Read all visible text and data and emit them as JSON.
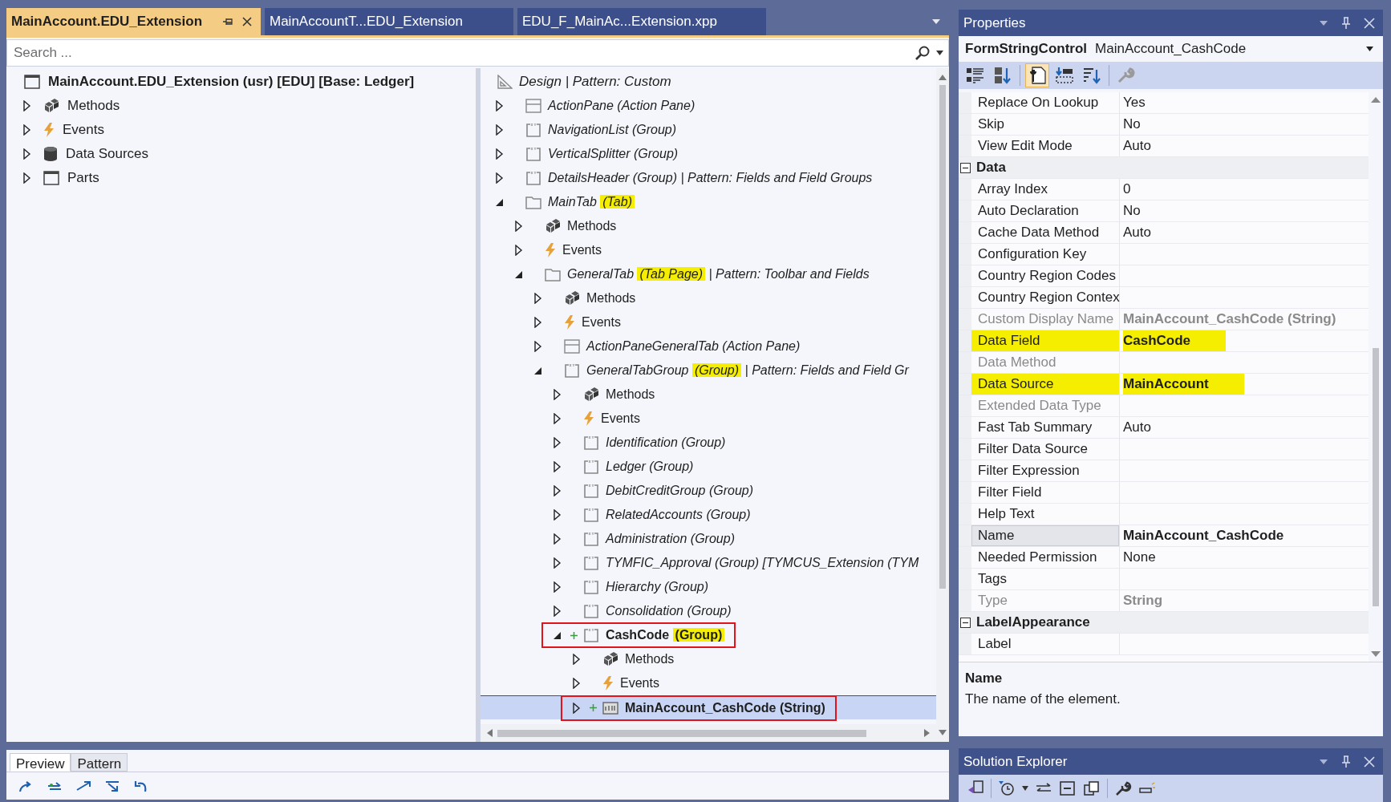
{
  "doc_tabs": [
    {
      "label": "MainAccount.EDU_Extension",
      "selected": true
    },
    {
      "label": "MainAccountT...EDU_Extension",
      "selected": false
    },
    {
      "label": "EDU_F_MainAc...Extension.xpp",
      "selected": false
    }
  ],
  "search": {
    "placeholder": "Search ..."
  },
  "element_tree": {
    "root": "MainAccount.EDU_Extension (usr) [EDU] [Base: Ledger]",
    "items": [
      {
        "name": "Methods",
        "kind": "methods",
        "expanded": false
      },
      {
        "name": "Events",
        "kind": "events",
        "expanded": false
      },
      {
        "name": "Data Sources",
        "kind": "datasource",
        "expanded": false
      },
      {
        "name": "Parts",
        "kind": "window",
        "expanded": false
      }
    ]
  },
  "designer": {
    "header": {
      "name": "Design",
      "suffix": " | Pattern: Custom"
    },
    "items": [
      {
        "name": "ActionPane",
        "type": "(Action Pane)",
        "kind": "actionpane",
        "expanded": false,
        "selected": false,
        "added": false,
        "highlighted": false
      },
      {
        "name": "NavigationList",
        "type": "(Group)",
        "kind": "group",
        "expanded": false,
        "selected": false,
        "added": false,
        "highlighted": false
      },
      {
        "name": "VerticalSplitter",
        "type": "(Group)",
        "kind": "group",
        "expanded": false,
        "selected": false,
        "added": false,
        "highlighted": false
      },
      {
        "name": "DetailsHeader",
        "type": "(Group)",
        "suffix": " | Pattern: Fields and Field Groups",
        "kind": "group",
        "expanded": false,
        "selected": false,
        "added": false,
        "highlighted": false
      },
      {
        "name": "MainTab",
        "type": "(Tab)",
        "kind": "tab",
        "expanded": true,
        "selected": false,
        "added": false,
        "highlighted": true,
        "children": [
          {
            "name": "Methods",
            "kind": "methods",
            "expanded": false,
            "selected": false,
            "added": false
          },
          {
            "name": "Events",
            "kind": "events",
            "expanded": false,
            "selected": false,
            "added": false
          },
          {
            "name": "GeneralTab",
            "type": "(Tab Page)",
            "suffix": " | Pattern: Toolbar and Fields",
            "kind": "tab",
            "expanded": true,
            "selected": false,
            "added": false,
            "highlighted": true,
            "children": [
              {
                "name": "Methods",
                "kind": "methods",
                "expanded": false,
                "selected": false,
                "added": false
              },
              {
                "name": "Events",
                "kind": "events",
                "expanded": false,
                "selected": false,
                "added": false
              },
              {
                "name": "ActionPaneGeneralTab",
                "type": "(Action Pane)",
                "kind": "actionpane",
                "expanded": false,
                "selected": false,
                "added": false,
                "highlighted": false
              },
              {
                "name": "GeneralTabGroup",
                "type": "(Group)",
                "suffix": " | Pattern: Fields and Field Gr",
                "kind": "group",
                "expanded": true,
                "selected": false,
                "added": false,
                "highlighted": true,
                "children": [
                  {
                    "name": "Methods",
                    "kind": "methods",
                    "expanded": false,
                    "selected": false,
                    "added": false
                  },
                  {
                    "name": "Events",
                    "kind": "events",
                    "expanded": false,
                    "selected": false,
                    "added": false
                  },
                  {
                    "name": "Identification",
                    "type": "(Group)",
                    "kind": "group",
                    "expanded": false,
                    "selected": false,
                    "added": false,
                    "highlighted": false
                  },
                  {
                    "name": "Ledger",
                    "type": "(Group)",
                    "kind": "group",
                    "expanded": false,
                    "selected": false,
                    "added": false,
                    "highlighted": false
                  },
                  {
                    "name": "DebitCreditGroup",
                    "type": "(Group)",
                    "kind": "group",
                    "expanded": false,
                    "selected": false,
                    "added": false,
                    "highlighted": false
                  },
                  {
                    "name": "RelatedAccounts",
                    "type": "(Group)",
                    "kind": "group",
                    "expanded": false,
                    "selected": false,
                    "added": false,
                    "highlighted": false
                  },
                  {
                    "name": "Administration",
                    "type": "(Group)",
                    "kind": "group",
                    "expanded": false,
                    "selected": false,
                    "added": false,
                    "highlighted": false
                  },
                  {
                    "name": "TYMFIC_Approval",
                    "type": "(Group)",
                    "suffix": " [TYMCUS_Extension (TYM",
                    "kind": "group",
                    "expanded": false,
                    "selected": false,
                    "added": false,
                    "highlighted": false
                  },
                  {
                    "name": "Hierarchy",
                    "type": "(Group)",
                    "kind": "group",
                    "expanded": false,
                    "selected": false,
                    "added": false,
                    "highlighted": false
                  },
                  {
                    "name": "Consolidation",
                    "type": "(Group)",
                    "kind": "group",
                    "expanded": false,
                    "selected": false,
                    "added": false,
                    "highlighted": false
                  },
                  {
                    "name": "CashCode",
                    "type": "(Group)",
                    "kind": "group",
                    "expanded": true,
                    "selected": false,
                    "added": true,
                    "highlighted": true,
                    "children": [
                      {
                        "name": "Methods",
                        "kind": "methods",
                        "expanded": false,
                        "selected": false,
                        "added": false
                      },
                      {
                        "name": "Events",
                        "kind": "events",
                        "expanded": false,
                        "selected": false,
                        "added": false
                      },
                      {
                        "name": "MainAccount_CashCode",
                        "type": "(String)",
                        "kind": "string",
                        "expanded": false,
                        "selected": true,
                        "added": true,
                        "highlighted": false
                      }
                    ]
                  }
                ]
              }
            ]
          }
        ]
      }
    ]
  },
  "preview_panel": {
    "tabs": [
      {
        "label": "Preview",
        "selected": true
      },
      {
        "label": "Pattern",
        "selected": false
      }
    ]
  },
  "properties": {
    "title": "Properties",
    "object_type": "FormStringControl",
    "object_name": "MainAccount_CashCode",
    "toolbar": [
      {
        "kind": "categorized",
        "selected": false
      },
      {
        "kind": "alphabetical",
        "selected": false
      },
      {
        "kind": "property-pages",
        "selected": true
      },
      {
        "kind": "events",
        "selected": false
      },
      {
        "kind": "sort",
        "selected": false
      },
      {
        "kind": "wrench",
        "selected": false
      }
    ],
    "rows": [
      {
        "kind": "property",
        "name": "Replace On Lookup",
        "value": "Yes",
        "readonly": false,
        "modified": false,
        "highlighted": false,
        "selected": false
      },
      {
        "kind": "property",
        "name": "Skip",
        "value": "No",
        "readonly": false,
        "modified": false,
        "highlighted": false,
        "selected": false
      },
      {
        "kind": "property",
        "name": "View Edit Mode",
        "value": "Auto",
        "readonly": false,
        "modified": false,
        "highlighted": false,
        "selected": false
      },
      {
        "kind": "category",
        "name": "Data",
        "expanded": true
      },
      {
        "kind": "property",
        "name": "Array Index",
        "value": "0",
        "readonly": false,
        "modified": false,
        "highlighted": false,
        "selected": false
      },
      {
        "kind": "property",
        "name": "Auto Declaration",
        "value": "No",
        "readonly": false,
        "modified": false,
        "highlighted": false,
        "selected": false
      },
      {
        "kind": "property",
        "name": "Cache Data Method",
        "value": "Auto",
        "readonly": false,
        "modified": false,
        "highlighted": false,
        "selected": false
      },
      {
        "kind": "property",
        "name": "Configuration Key",
        "readonly": false,
        "highlighted": false,
        "selected": false
      },
      {
        "kind": "property",
        "name": "Country Region Codes",
        "readonly": false,
        "highlighted": false,
        "selected": false
      },
      {
        "kind": "property",
        "name": "Country Region Contex",
        "readonly": false,
        "highlighted": false,
        "selected": false
      },
      {
        "kind": "property",
        "name": "Custom Display Name",
        "value": "MainAccount_CashCode (String)",
        "readonly": true,
        "modified": true,
        "highlighted": false,
        "selected": false
      },
      {
        "kind": "property",
        "name": "Data Field",
        "value": "CashCode",
        "readonly": false,
        "modified": true,
        "highlighted": true,
        "selected": false
      },
      {
        "kind": "property",
        "name": "Data Method",
        "readonly": true,
        "highlighted": false,
        "selected": false
      },
      {
        "kind": "property",
        "name": "Data Source",
        "value": "MainAccount",
        "readonly": false,
        "modified": true,
        "highlighted": true,
        "selected": false
      },
      {
        "kind": "property",
        "name": "Extended Data Type",
        "readonly": true,
        "highlighted": false,
        "selected": false
      },
      {
        "kind": "property",
        "name": "Fast Tab Summary",
        "value": "Auto",
        "readonly": false,
        "modified": false,
        "highlighted": false,
        "selected": false
      },
      {
        "kind": "property",
        "name": "Filter Data Source",
        "readonly": false,
        "highlighted": false,
        "selected": false
      },
      {
        "kind": "property",
        "name": "Filter Expression",
        "readonly": false,
        "highlighted": false,
        "selected": false
      },
      {
        "kind": "property",
        "name": "Filter Field",
        "readonly": false,
        "highlighted": false,
        "selected": false
      },
      {
        "kind": "property",
        "name": "Help Text",
        "readonly": false,
        "highlighted": false,
        "selected": false
      },
      {
        "kind": "property",
        "name": "Name",
        "value": "MainAccount_CashCode",
        "readonly": false,
        "modified": true,
        "highlighted": false,
        "selected": true
      },
      {
        "kind": "property",
        "name": "Needed Permission",
        "value": "None",
        "readonly": false,
        "modified": false,
        "highlighted": false,
        "selected": false
      },
      {
        "kind": "property",
        "name": "Tags",
        "readonly": false,
        "highlighted": false,
        "selected": false
      },
      {
        "kind": "property",
        "name": "Type",
        "value": "String",
        "readonly": true,
        "modified": true,
        "highlighted": false,
        "selected": false
      },
      {
        "kind": "category",
        "name": "LabelAppearance",
        "expanded": true
      },
      {
        "kind": "property",
        "name": "Label",
        "readonly": false,
        "highlighted": false,
        "selected": false
      }
    ],
    "description": {
      "title": "Name",
      "text": "The name of the element."
    }
  },
  "solution_explorer": {
    "title": "Solution Explorer"
  }
}
